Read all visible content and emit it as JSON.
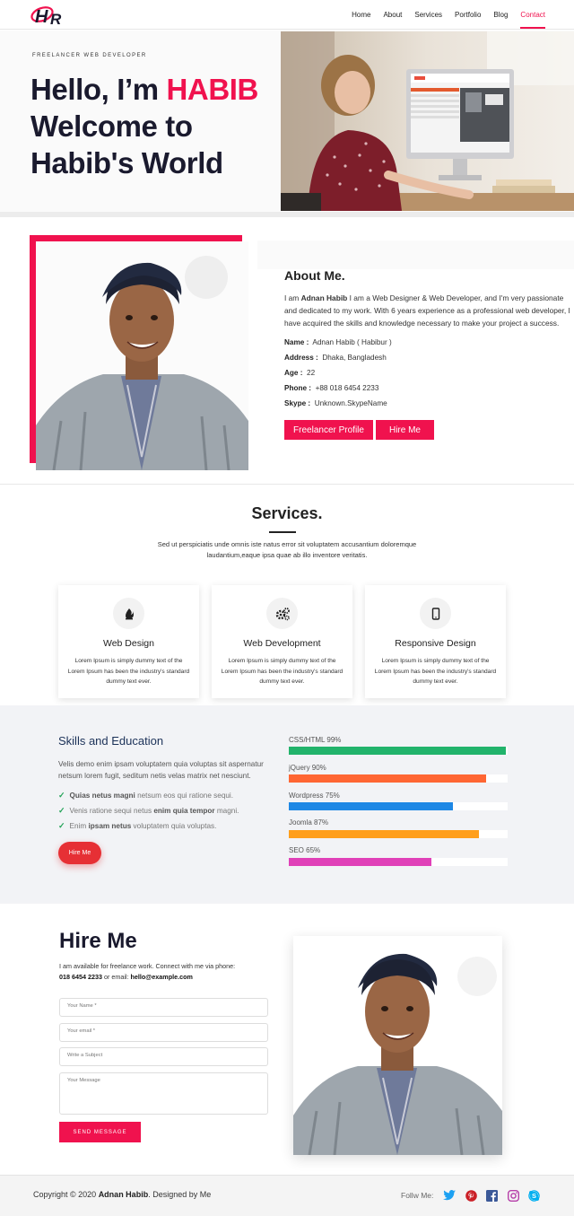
{
  "header": {
    "logo_text": "HR",
    "nav": [
      "Home",
      "About",
      "Services",
      "Portfolio",
      "Blog",
      "Contact"
    ],
    "active_nav": "Contact"
  },
  "hero": {
    "tagline": "FREELANCER WEB DEVELOPER",
    "line1_prefix": "Hello, I’m ",
    "line1_name": "HABIB",
    "line2": "Welcome to",
    "line3": "Habib's World"
  },
  "about": {
    "title": "About Me.",
    "intro_prefix": "I am ",
    "intro_name": "Adnan Habib",
    "intro_rest": " I am a Web Designer & Web Developer, and I'm very passionate and dedicated to my work. With 6 years experience as a professional web developer, I have acquired the skills and knowledge necessary to make your project a success.",
    "info": [
      {
        "label": "Name :",
        "value": "Adnan Habib ( Habibur )"
      },
      {
        "label": "Address :",
        "value": "Dhaka, Bangladesh"
      },
      {
        "label": "Age :",
        "value": "22"
      },
      {
        "label": "Phone :",
        "value": "+88 018 6454 2233"
      },
      {
        "label": "Skype :",
        "value": "Unknown.SkypeName"
      }
    ],
    "btn_profile": "Freelancer Profile",
    "btn_hire": "Hire Me"
  },
  "services": {
    "title": "Services.",
    "desc": "Sed ut perspiciatis unde omnis iste natus error sit voluptatem accusantium doloremque laudantium,eaque ipsa quae ab illo inventore veritatis.",
    "cards": [
      {
        "title": "Web Design",
        "icon": "flame-icon",
        "text": "Lorem Ipsum is simply dummy text of the Lorem Ipsum has been the industry's standard dummy text ever."
      },
      {
        "title": "Web Development",
        "icon": "gears-icon",
        "text": "Lorem Ipsum is simply dummy text of the Lorem Ipsum has been the industry's standard dummy text ever."
      },
      {
        "title": "Responsive Design",
        "icon": "mobile-icon",
        "text": "Lorem Ipsum is simply dummy text of the Lorem Ipsum has been the industry's standard dummy text ever."
      }
    ]
  },
  "skills": {
    "title": "Skills and Education",
    "desc": "Velis demo enim ipsam voluptatem quia voluptas sit aspernatur netsum lorem fugit, seditum netis velas matrix net nesciunt.",
    "items": [
      {
        "bold": "Quias netus magni",
        "pre": "",
        "rest": " netsum eos qui ratione sequi."
      },
      {
        "pre": "Venis ratione sequi netus ",
        "bold": "enim quia tempor",
        "rest": " magni."
      },
      {
        "pre": "Enim ",
        "bold": "ipsam netus",
        "rest": " voluptatem quia voluptas."
      }
    ],
    "hire_btn": "Hire Me",
    "bars": [
      {
        "label": "CSS/HTML 99%",
        "value": 99,
        "color": "#22b36b"
      },
      {
        "label": "jQuery 90%",
        "value": 90,
        "color": "#ff6633"
      },
      {
        "label": "Wordpress 75%",
        "value": 75,
        "color": "#1e88e5"
      },
      {
        "label": "Joomla 87%",
        "value": 87,
        "color": "#ff9f1c"
      },
      {
        "label": "SEO 65%",
        "value": 65,
        "color": "#e040b8"
      }
    ]
  },
  "hire": {
    "title": "Hire Me",
    "text_line1": "I am available for freelance work. Connect with me via phone:",
    "phone": "018 6454 2233",
    "text_or": " or email: ",
    "email": "hello@example.com",
    "fields": {
      "name": "Your Name *",
      "email": "Your email *",
      "subject": "Write a Subject",
      "message": "Your Message"
    },
    "send": "SEND MESSAGE"
  },
  "footer": {
    "copy_prefix": "Copyright © 2020 ",
    "copy_name": "Adnan Habib",
    "copy_suffix": ". Designed by Me",
    "follow": "Follw Me:",
    "socials": [
      "twitter-icon",
      "pinterest-icon",
      "facebook-icon",
      "instagram-icon",
      "skype-icon"
    ]
  },
  "colors": {
    "accent": "#f0124e",
    "navy": "#1b3158",
    "check": "#22a357"
  }
}
